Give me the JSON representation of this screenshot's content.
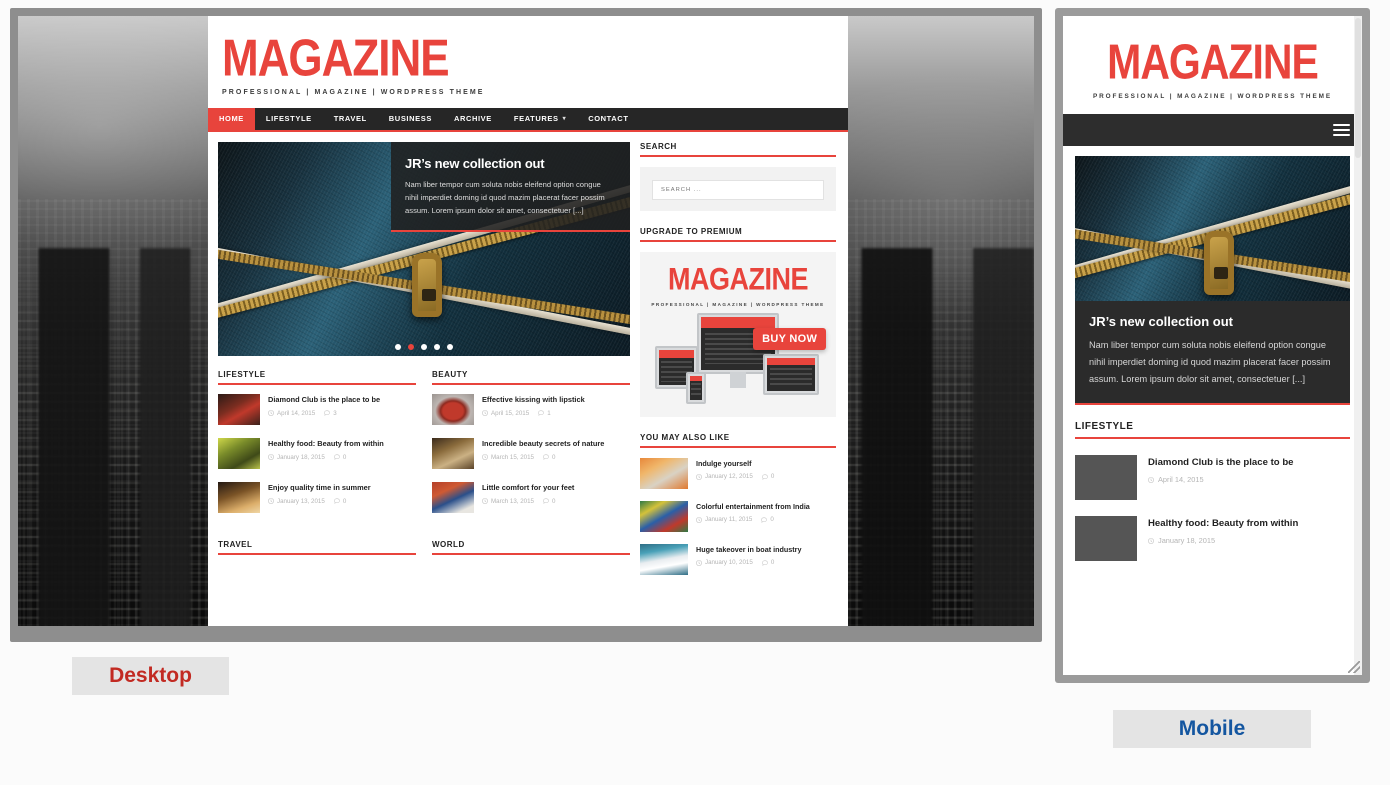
{
  "labels": {
    "desktop": "Desktop",
    "mobile": "Mobile"
  },
  "colors": {
    "brand_red": "#e8443c",
    "nav_dark": "#262626",
    "desktop_label": "#c22a22",
    "mobile_label": "#1456a0"
  },
  "site": {
    "logo": "MAGAZINE",
    "tagline": "PROFESSIONAL | MAGAZINE | WORDPRESS THEME",
    "nav": [
      {
        "label": "HOME",
        "active": true,
        "caret": false
      },
      {
        "label": "LIFESTYLE",
        "active": false,
        "caret": false
      },
      {
        "label": "TRAVEL",
        "active": false,
        "caret": false
      },
      {
        "label": "BUSINESS",
        "active": false,
        "caret": false
      },
      {
        "label": "ARCHIVE",
        "active": false,
        "caret": false
      },
      {
        "label": "FEATURES",
        "active": false,
        "caret": true
      },
      {
        "label": "CONTACT",
        "active": false,
        "caret": false
      }
    ],
    "hero": {
      "title": "JR’s new collection out",
      "text": "Nam liber tempor cum soluta nobis eleifend option congue nihil imperdiet doming id quod mazim placerat facer possim assum. Lorem ipsum dolor sit amet, consectetuer [...]",
      "slide_count": 5,
      "active_slide": 2
    },
    "categories": [
      {
        "name": "LIFESTYLE",
        "posts": [
          {
            "title": "Diamond Club is the place to be",
            "date": "April 14, 2015",
            "comments": "3",
            "art": "t-bar"
          },
          {
            "title": "Healthy food: Beauty from within",
            "date": "January 18, 2015",
            "comments": "0",
            "art": "t-salad"
          },
          {
            "title": "Enjoy quality time in summer",
            "date": "January 13, 2015",
            "comments": "0",
            "art": "t-field2"
          }
        ]
      },
      {
        "name": "BEAUTY",
        "posts": [
          {
            "title": "Effective kissing with lipstick",
            "date": "April 15, 2015",
            "comments": "1",
            "art": "t-lips"
          },
          {
            "title": "Incredible beauty secrets of nature",
            "date": "March 15, 2015",
            "comments": "0",
            "art": "t-nature"
          },
          {
            "title": "Little comfort for your feet",
            "date": "March 13, 2015",
            "comments": "0",
            "art": "t-shoes"
          }
        ]
      }
    ],
    "lower_categories": [
      {
        "name": "TRAVEL"
      },
      {
        "name": "WORLD"
      }
    ],
    "sidebar": {
      "search": {
        "heading": "SEARCH",
        "placeholder": "SEARCH ..."
      },
      "promo": {
        "heading": "UPGRADE TO PREMIUM",
        "logo": "MAGAZINE",
        "tagline": "PROFESSIONAL | MAGAZINE | WORDPRESS THEME",
        "cta": "BUY NOW"
      },
      "related": {
        "heading": "YOU MAY ALSO LIKE",
        "posts": [
          {
            "title": "Indulge yourself",
            "date": "January 12, 2015",
            "comments": "0",
            "art": "t-food"
          },
          {
            "title": "Colorful entertainment from India",
            "date": "January 11, 2015",
            "comments": "0",
            "art": "t-carn"
          },
          {
            "title": "Huge takeover in boat industry",
            "date": "January 10, 2015",
            "comments": "0",
            "art": "t-boat"
          }
        ]
      }
    }
  },
  "mobile": {
    "logo": "MAGAZINE",
    "tagline": "PROFESSIONAL | MAGAZINE | WORDPRESS THEME",
    "menu_icon": "hamburger-icon",
    "hero": {
      "title": "JR’s new collection out",
      "text": "Nam liber tempor cum soluta nobis eleifend option congue nihil imperdiet doming id quod mazim placerat facer possim assum. Lorem ipsum dolor sit amet, consectetuer [...]"
    },
    "category": "LIFESTYLE",
    "posts": [
      {
        "title": "Diamond Club is the place to be",
        "date": "April 14, 2015",
        "art": "t-bar"
      },
      {
        "title": "Healthy food: Beauty from within",
        "date": "January 18, 2015",
        "art": "t-salad"
      }
    ]
  }
}
